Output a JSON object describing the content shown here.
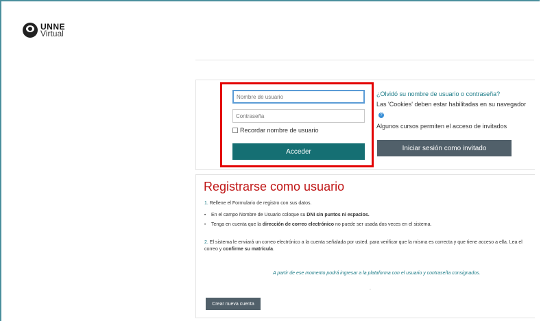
{
  "logo": {
    "line1": "UNNE",
    "line2": "Virtual"
  },
  "login": {
    "username_placeholder": "Nombre de usuario",
    "password_placeholder": "Contraseña",
    "remember_label": "Recordar nombre de usuario",
    "submit_label": "Acceder"
  },
  "info": {
    "forgot_link": "¿Olvidó su nombre de usuario o contraseña?",
    "cookies_text": "Las 'Cookies' deben estar habilitadas en su navegador",
    "guest_text": "Algunos cursos permiten el acceso de invitados",
    "guest_button": "Iniciar sesión como invitado"
  },
  "register": {
    "title": "Registrarse como usuario",
    "step1_num": "1.",
    "step1": "Rellene el Formulario de registro con sus datos.",
    "bullet1_pre": "En el campo Nombre de Usuario coloque su ",
    "bullet1_bold": "DNI sin puntos ni espacios.",
    "bullet2_pre": "Tenga en cuenta que la ",
    "bullet2_bold": "dirección de correo electrónico",
    "bullet2_post": " no puede ser usada dos veces en el sistema.",
    "step2_num": "2.",
    "step2": "El sistema le enviará un correo electrónico a la cuenta señalada por usted. para verificar que la misma es correcta y que tiene acceso a ella. Lea el correo y",
    "step2_bold": "confirme su matrícula",
    "step2_end": ".",
    "note": "A partir de ese momento podrá ingresar a la plataforma con el usuario y contraseña consignados.",
    "dot": ".",
    "create_button": "Crear nueva cuenta"
  },
  "colors": {
    "primary": "#156f73",
    "secondary": "#51606a",
    "accent_red": "#c01616",
    "link": "#1a7a86"
  }
}
